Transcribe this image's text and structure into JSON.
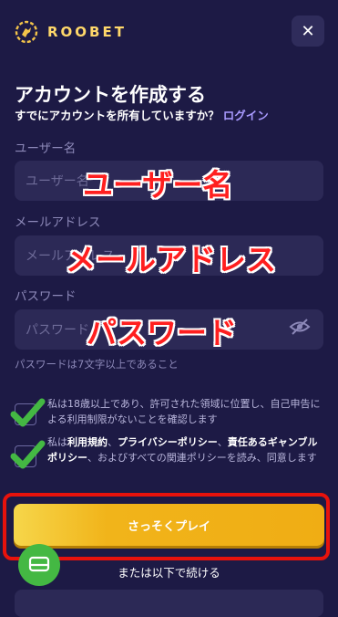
{
  "header": {
    "brand": "ROOBET",
    "close_label": "✕"
  },
  "form": {
    "title": "アカウントを作成する",
    "subtitle": "すでにアカウントを所有していますか？",
    "login_link": "ログイン",
    "username": {
      "label": "ユーザー名",
      "placeholder": "ユーザー名",
      "overlay": "ユーザー名"
    },
    "email": {
      "label": "メールアドレス",
      "placeholder": "メールアドレス",
      "overlay": "メールアドレス"
    },
    "password": {
      "label": "パスワード",
      "placeholder": "パスワード",
      "overlay": "パスワード",
      "hint": "パスワードは7文字以上であること"
    },
    "consent_age": "私は18歳以上であり、許可された領域に位置し、自己申告による利用制限がないことを確認します",
    "consent_terms": {
      "prefix": "私は",
      "terms": "利用規約",
      "sep1": "、",
      "privacy": "プライバシーポリシー",
      "sep2": "、",
      "gambling": "責任あるギャンブルポリシー",
      "suffix": "、およびすべての関連ポリシーを読み、同意します"
    },
    "play_button": "さっそくプレイ",
    "or_continue": "または以下で続ける"
  },
  "colors": {
    "background": "#1d1a45",
    "input": "#2c2956",
    "accent": "#f0ad14",
    "highlight": "#e8120c",
    "check": "#44b843"
  }
}
